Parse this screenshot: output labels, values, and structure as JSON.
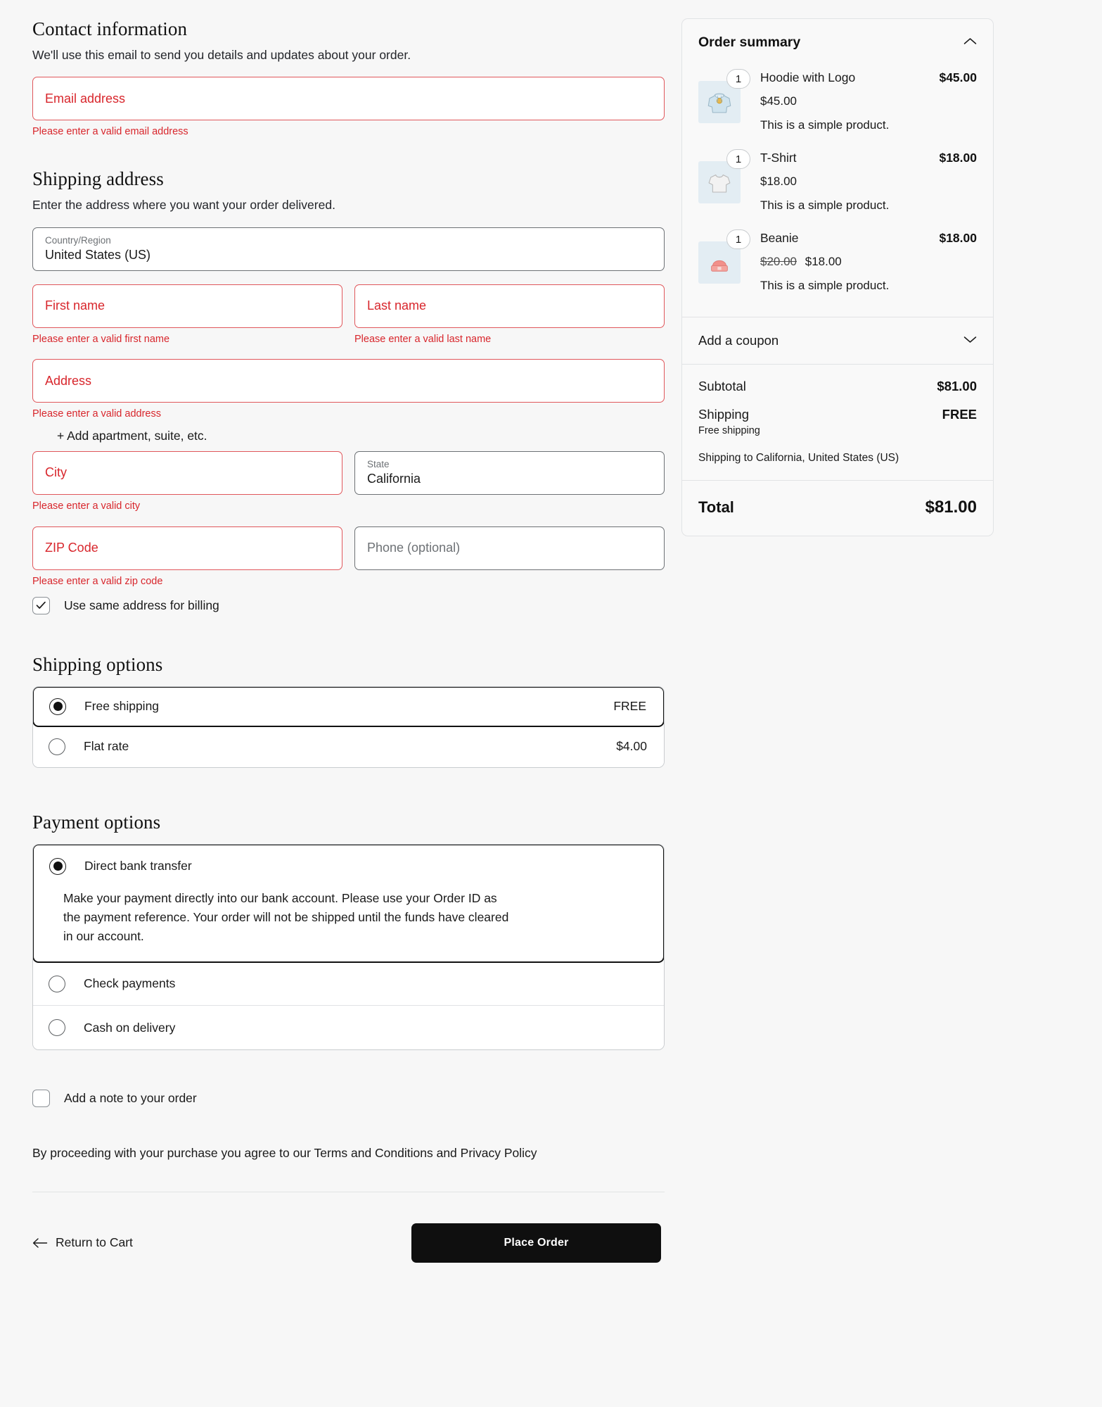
{
  "contact": {
    "title": "Contact information",
    "description": "We'll use this email to send you details and updates about your order.",
    "email_placeholder": "Email address",
    "email_error": "Please enter a valid email address"
  },
  "shipping_address": {
    "title": "Shipping address",
    "description": "Enter the address where you want your order delivered.",
    "country_label": "Country/Region",
    "country_value": "United States (US)",
    "first_name_placeholder": "First name",
    "first_name_error": "Please enter a valid first name",
    "last_name_placeholder": "Last name",
    "last_name_error": "Please enter a valid last name",
    "address_placeholder": "Address",
    "address_error": "Please enter a valid address",
    "add_apartment": "+ Add apartment, suite, etc.",
    "city_placeholder": "City",
    "city_error": "Please enter a valid city",
    "state_label": "State",
    "state_value": "California",
    "zip_placeholder": "ZIP Code",
    "zip_error": "Please enter a valid zip code",
    "phone_placeholder": "Phone (optional)",
    "billing_checkbox_label": "Use same address for billing",
    "billing_checkbox_checked": true
  },
  "shipping_options": {
    "title": "Shipping options",
    "options": [
      {
        "label": "Free shipping",
        "price": "FREE",
        "selected": true
      },
      {
        "label": "Flat rate",
        "price": "$4.00",
        "selected": false
      }
    ]
  },
  "payment_options": {
    "title": "Payment options",
    "options": [
      {
        "label": "Direct bank transfer",
        "selected": true,
        "description": "Make your payment directly into our bank account. Please use your Order ID as the payment reference. Your order will not be shipped until the funds have cleared in our account."
      },
      {
        "label": "Check payments",
        "selected": false,
        "description": ""
      },
      {
        "label": "Cash on delivery",
        "selected": false,
        "description": ""
      }
    ]
  },
  "order_note": {
    "label": "Add a note to your order",
    "checked": false
  },
  "terms_text": "By proceeding with your purchase you agree to our Terms and Conditions and Privacy Policy",
  "footer": {
    "return_label": "Return to Cart",
    "place_order_label": "Place Order"
  },
  "order_summary": {
    "title": "Order summary",
    "items": [
      {
        "qty": "1",
        "name": "Hoodie with Logo",
        "line_total": "$45.00",
        "price": "$45.00",
        "was_price": "",
        "note": "This is a simple product.",
        "icon": "hoodie-icon"
      },
      {
        "qty": "1",
        "name": "T-Shirt",
        "line_total": "$18.00",
        "price": "$18.00",
        "was_price": "",
        "note": "This is a simple product.",
        "icon": "tshirt-icon"
      },
      {
        "qty": "1",
        "name": "Beanie",
        "line_total": "$18.00",
        "price": "$18.00",
        "was_price": "$20.00",
        "note": "This is a simple product.",
        "icon": "beanie-icon"
      }
    ],
    "coupon_label": "Add a coupon",
    "subtotal_label": "Subtotal",
    "subtotal_value": "$81.00",
    "shipping_label": "Shipping",
    "shipping_value": "FREE",
    "shipping_method": "Free shipping",
    "shipping_to": "Shipping to California, United States (US)",
    "total_label": "Total",
    "total_value": "$81.00"
  },
  "colors": {
    "error": "#d8262c",
    "accent_dark": "#0f0f0f",
    "thumb_bg": "#e3edf3"
  }
}
